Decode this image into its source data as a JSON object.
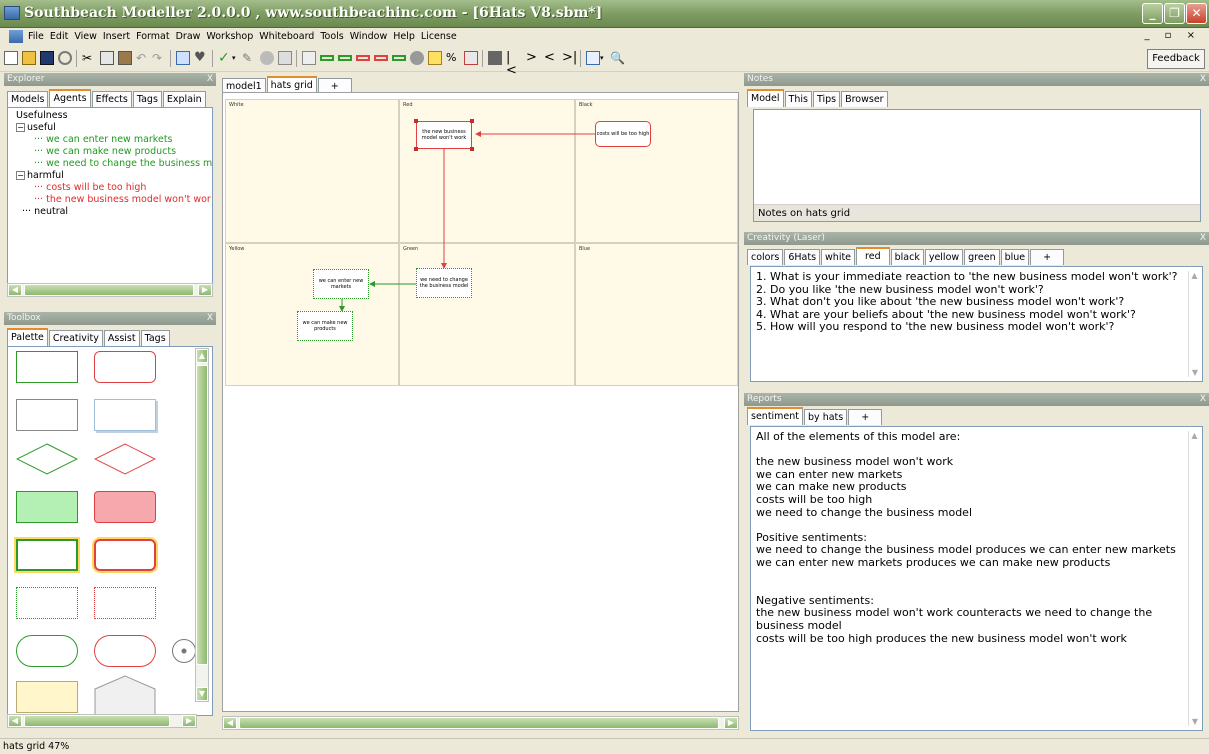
{
  "window": {
    "title": "Southbeach Modeller 2.0.0.0 , www.southbeachinc.com - [6Hats V8.sbm*]"
  },
  "menu": [
    "File",
    "Edit",
    "View",
    "Insert",
    "Format",
    "Draw",
    "Workshop",
    "Whiteboard",
    "Tools",
    "Window",
    "Help",
    "License"
  ],
  "mdi_controls": "_ ▫ ×",
  "toolbar": {
    "feedback_label": "Feedback"
  },
  "explorer": {
    "title": "Explorer",
    "tabs": [
      "Models",
      "Agents",
      "Effects",
      "Tags",
      "Explain"
    ],
    "active_tab": "Agents",
    "tree": {
      "root": "Usefulness",
      "useful": "useful",
      "useful_items": [
        "we can enter new markets",
        "we can make new products",
        "we need to change the business m"
      ],
      "harmful": "harmful",
      "harmful_items": [
        "costs will be too high",
        "the new business model won't wor"
      ],
      "neutral": "neutral"
    }
  },
  "toolbox": {
    "title": "Toolbox",
    "tabs": [
      "Palette",
      "Creativity",
      "Assist",
      "Tags"
    ],
    "active_tab": "Palette"
  },
  "document_tabs": [
    "model1",
    "hats grid",
    "+"
  ],
  "active_document_tab": "hats grid",
  "grid": {
    "cells": [
      "White",
      "Red",
      "Black",
      "Yellow",
      "Green",
      "Blue"
    ],
    "nodes": {
      "red": "the new business model won't work",
      "black": "costs will be too high",
      "green": "we need to change the business model",
      "yellow1": "we can enter new markets",
      "yellow2": "we can make new products"
    }
  },
  "notes": {
    "title": "Notes",
    "tabs": [
      "Model",
      "This",
      "Tips",
      "Browser"
    ],
    "active_tab": "Model",
    "caption": "Notes on hats grid"
  },
  "creativity": {
    "title": "Creativity (Laser)",
    "tabs": [
      "colors",
      "6Hats",
      "white",
      "red",
      "black",
      "yellow",
      "green",
      "blue",
      "+"
    ],
    "active_tab": "red",
    "questions": [
      "1.  What is your immediate reaction to 'the new business model won't work'?",
      "2.  Do you like 'the new business model won't work'?",
      "3.  What don't you like about 'the new business model won't work'?",
      "4.  What are your beliefs about 'the new business model won't work'?",
      "5.  How will you respond to 'the new business model won't work'?"
    ]
  },
  "reports": {
    "title": "Reports",
    "tabs": [
      "sentiment",
      "by hats",
      "+"
    ],
    "active_tab": "sentiment",
    "text": "All of the elements of this model are:\n\nthe new business model won't work\nwe can enter new markets\nwe can make new products\ncosts will be too high\nwe need to change the business model\n\nPositive sentiments:\nwe need to change the business model produces we can enter new markets\nwe can enter new markets produces we can make new products\n\n\nNegative sentiments:\nthe new business model won't work counteracts we need to change the business model\ncosts will be too high produces the new business model won't work"
  },
  "status": {
    "text": "hats grid  47%"
  },
  "colors": {
    "accent": "#e68b2c",
    "title_green": "#7f9d63",
    "harmful_red": "#e32a2a",
    "useful_green": "#1f9a1f"
  }
}
